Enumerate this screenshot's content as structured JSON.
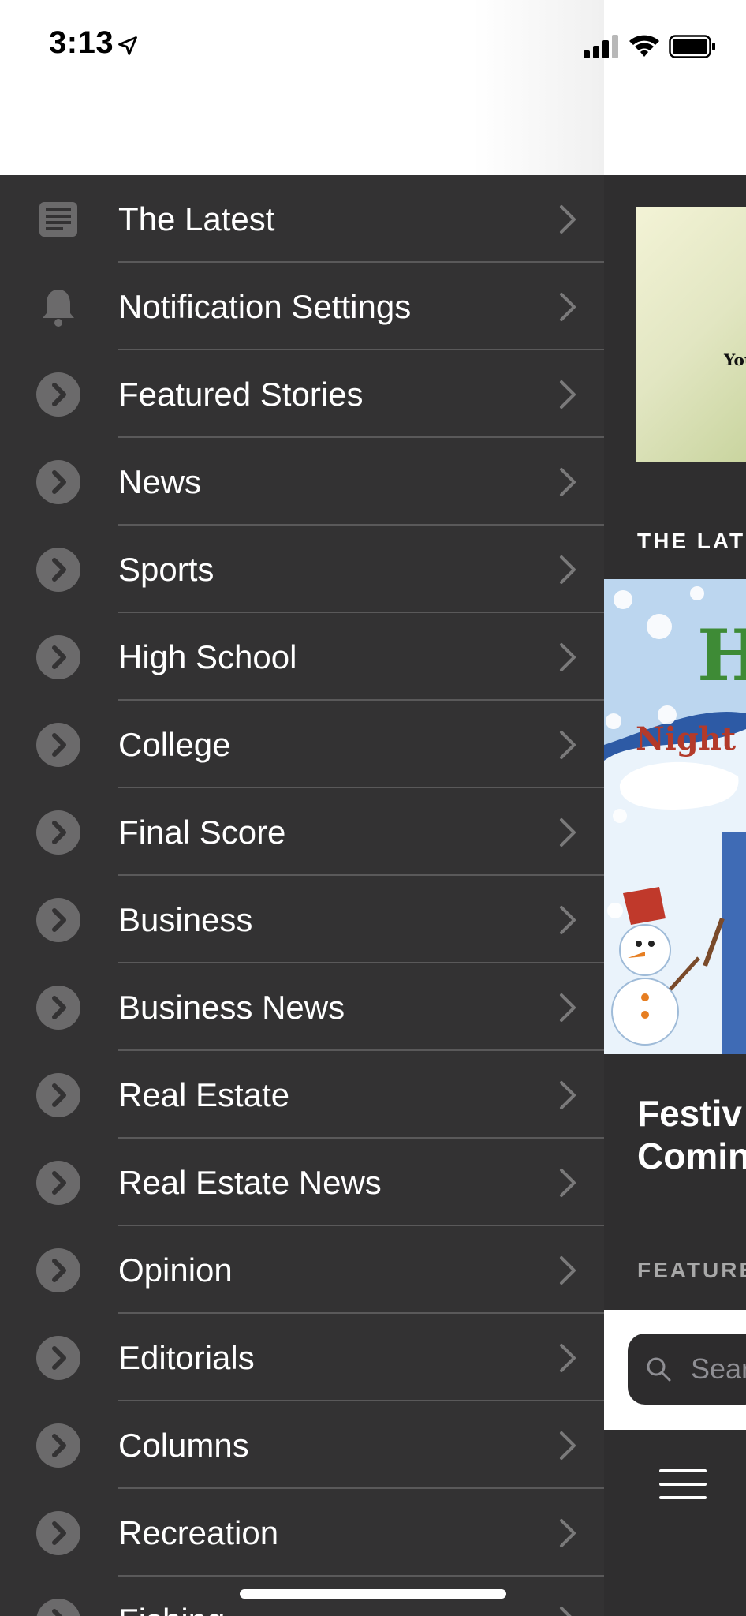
{
  "status_bar": {
    "time": "3:13"
  },
  "menu": {
    "items": [
      {
        "label": "The Latest",
        "icon": "newspaper-icon"
      },
      {
        "label": "Notification Settings",
        "icon": "bell-icon"
      },
      {
        "label": "Featured Stories",
        "icon": "chevron-circle-icon"
      },
      {
        "label": "News",
        "icon": "chevron-circle-icon"
      },
      {
        "label": "Sports",
        "icon": "chevron-circle-icon"
      },
      {
        "label": "High School",
        "icon": "chevron-circle-icon"
      },
      {
        "label": "College",
        "icon": "chevron-circle-icon"
      },
      {
        "label": "Final Score",
        "icon": "chevron-circle-icon"
      },
      {
        "label": "Business",
        "icon": "chevron-circle-icon"
      },
      {
        "label": "Business News",
        "icon": "chevron-circle-icon"
      },
      {
        "label": "Real Estate",
        "icon": "chevron-circle-icon"
      },
      {
        "label": "Real Estate News",
        "icon": "chevron-circle-icon"
      },
      {
        "label": "Opinion",
        "icon": "chevron-circle-icon"
      },
      {
        "label": "Editorials",
        "icon": "chevron-circle-icon"
      },
      {
        "label": "Columns",
        "icon": "chevron-circle-icon"
      },
      {
        "label": "Recreation",
        "icon": "chevron-circle-icon"
      },
      {
        "label": "Fishing",
        "icon": "chevron-circle-icon"
      }
    ]
  },
  "panel": {
    "hero_text": "You",
    "section_latest": "THE LAT",
    "festive_image_text_1": "Ho",
    "festive_image_text_2": "Night L",
    "story_title_line1": "Festiv",
    "story_title_line2": "Comin",
    "section_featured": "FEATURE",
    "search_placeholder": "Sear"
  },
  "colors": {
    "drawer_bg": "#333233",
    "divider": "#5a595a",
    "icon_gray": "#6b6a6b",
    "text_white": "#ffffff"
  }
}
